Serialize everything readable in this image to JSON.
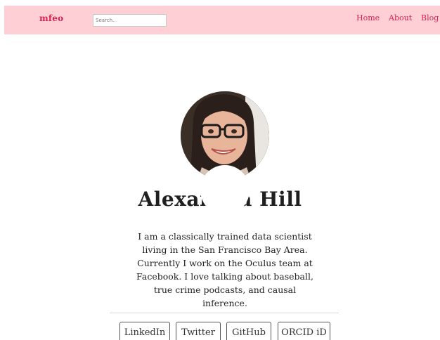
{
  "nav": {
    "brand": "mfeo",
    "search_placeholder": "Search..",
    "links": [
      "Home",
      "About",
      "Blog"
    ]
  },
  "profile": {
    "name": "Alexandra Hill",
    "bio": "I am a classically trained data scientist living in the San Francisco Bay Area. Currently I work on the Oculus team at Facebook. I love talking about baseball, true crime podcasts, and causal inference."
  },
  "social_links": [
    "LinkedIn",
    "Twitter",
    "GitHub",
    "ORCID iD"
  ],
  "colors": {
    "navbar_bg": "#ffcfd6",
    "accent": "#d6224f"
  }
}
